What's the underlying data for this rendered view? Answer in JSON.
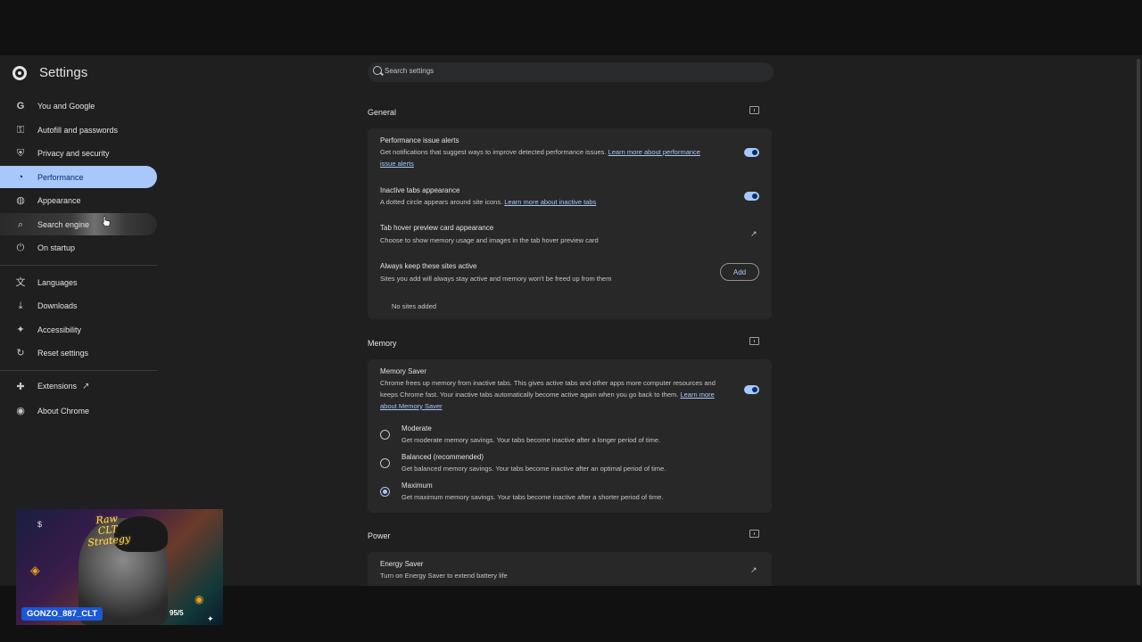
{
  "app": {
    "title": "Settings"
  },
  "sidebar": {
    "items": [
      {
        "label": "You and Google",
        "icon": "google-icon"
      },
      {
        "label": "Autofill and passwords",
        "icon": "key-icon"
      },
      {
        "label": "Privacy and security",
        "icon": "shield-icon"
      },
      {
        "label": "Performance",
        "icon": "gauge-icon",
        "active": true
      },
      {
        "label": "Appearance",
        "icon": "palette-icon"
      },
      {
        "label": "Search engine",
        "icon": "search-icon"
      },
      {
        "label": "On startup",
        "icon": "power-icon"
      },
      {
        "label": "Languages",
        "icon": "translate-icon"
      },
      {
        "label": "Downloads",
        "icon": "download-icon"
      },
      {
        "label": "Accessibility",
        "icon": "accessibility-icon"
      },
      {
        "label": "Reset settings",
        "icon": "reset-icon"
      },
      {
        "label": "Extensions",
        "icon": "extension-icon"
      },
      {
        "label": "About Chrome",
        "icon": "chrome-icon"
      }
    ]
  },
  "search": {
    "placeholder": "Search settings"
  },
  "general": {
    "title": "General",
    "perf_alerts": {
      "title": "Performance issue alerts",
      "desc": "Get notifications that suggest ways to improve detected performance issues.",
      "link": "Learn more about performance issue alerts",
      "enabled": true
    },
    "inactive_tabs": {
      "title": "Inactive tabs appearance",
      "desc": "A dotted circle appears around site icons.",
      "link": "Learn more about inactive tabs",
      "enabled": true
    },
    "hover_card": {
      "title": "Tab hover preview card appearance",
      "desc": "Choose to show memory usage and images in the tab hover preview card"
    },
    "keep_active": {
      "title": "Always keep these sites active",
      "desc": "Sites you add will always stay active and memory won't be freed up from them",
      "add_label": "Add",
      "empty": "No sites added"
    }
  },
  "memory": {
    "title": "Memory",
    "saver": {
      "title": "Memory Saver",
      "desc": "Chrome frees up memory from inactive tabs. This gives active tabs and other apps more computer resources and keeps Chrome fast. Your inactive tabs automatically become active again when you go back to them.",
      "link": "Learn more about Memory Saver",
      "enabled": true
    },
    "options": [
      {
        "title": "Moderate",
        "desc": "Get moderate memory savings. Your tabs become inactive after a longer period of time.",
        "checked": false
      },
      {
        "title": "Balanced (recommended)",
        "desc": "Get balanced memory savings. Your tabs become inactive after an optimal period of time.",
        "checked": false
      },
      {
        "title": "Maximum",
        "desc": "Get maximum memory savings. Your tabs become inactive after a shorter period of time.",
        "checked": true
      }
    ]
  },
  "power": {
    "title": "Power",
    "energy": {
      "title": "Energy Saver",
      "desc": "Turn on Energy Saver to extend battery life"
    }
  },
  "webcam": {
    "overlay_text": "Raw CLT Strategy",
    "username": "GONZO_887_CLT",
    "counter": "95/5"
  },
  "colors": {
    "accent": "#a8c7fa",
    "background": "#1f1f1f",
    "card": "#282828",
    "badge": "#1b57d6"
  }
}
